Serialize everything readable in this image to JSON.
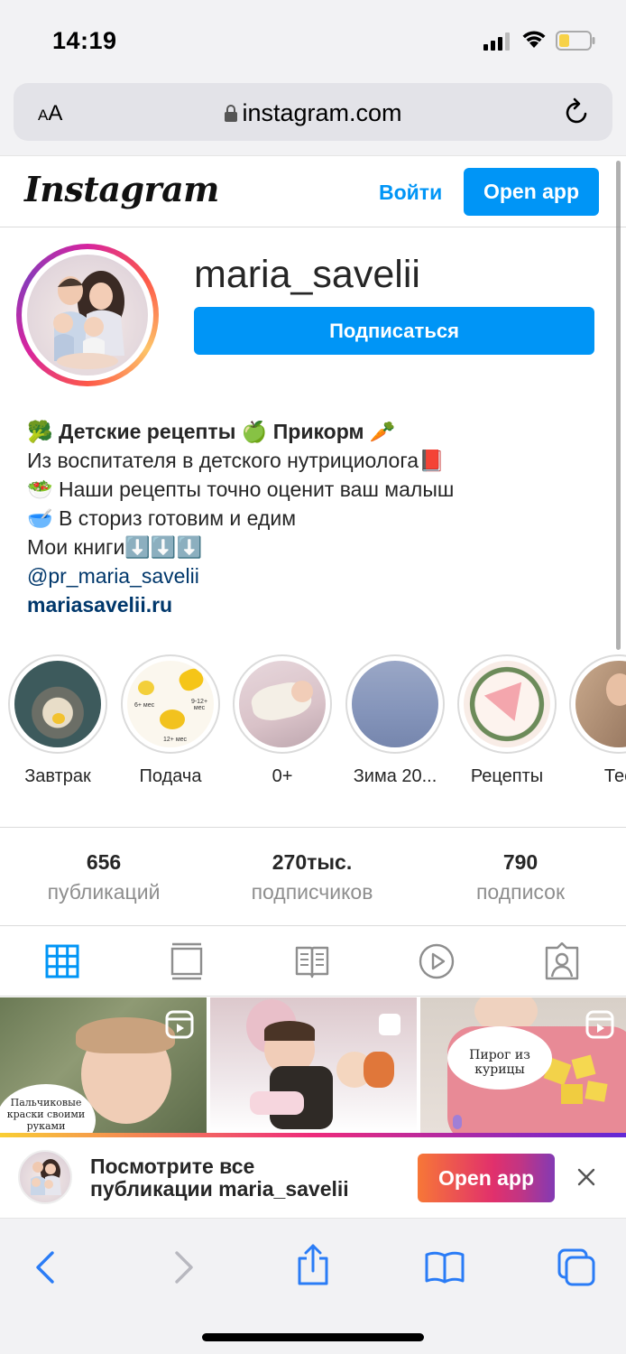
{
  "status": {
    "time": "14:19"
  },
  "browser": {
    "aa_small": "A",
    "aa_large": "A",
    "url": "instagram.com"
  },
  "header": {
    "logo": "Instagram",
    "login": "Войти",
    "open_app": "Open app"
  },
  "profile": {
    "username": "maria_savelii",
    "follow": "Подписаться",
    "bio": [
      "🥦 Детские рецепты 🍏 Прикорм 🥕",
      "Из воспитателя в детского нутрициолога📕",
      "🥗 Наши рецепты точно оценит ваш малыш",
      "🥣 В сториз готовим и едим",
      "Мои книги⬇️⬇️⬇️"
    ],
    "mention": "@pr_maria_savelii",
    "website": "mariasavelii.ru"
  },
  "highlights": [
    {
      "label": "Завтрак"
    },
    {
      "label": "Подача"
    },
    {
      "label": "0+"
    },
    {
      "label": "Зима 20..."
    },
    {
      "label": "Рецепты"
    },
    {
      "label": "Тес"
    }
  ],
  "highlight_texts": {
    "podacha_a": "6+ мес",
    "podacha_b": "9-12+ мес",
    "podacha_c": "12+ мес"
  },
  "stats": [
    {
      "value": "656",
      "label": "публикаций"
    },
    {
      "value": "270тыс.",
      "label": "подписчиков"
    },
    {
      "value": "790",
      "label": "подписок"
    }
  ],
  "posts": [
    {
      "caption": "Пальчиковые краски своими руками"
    },
    {
      "caption": ""
    },
    {
      "caption": "Пирог из курицы"
    }
  ],
  "banner": {
    "line1": "Посмотрите все",
    "line2": "публикации maria_savelii",
    "open_app": "Open app"
  },
  "colors": {
    "primary_blue": "#0095f6",
    "link_dark": "#00376b",
    "muted": "#8e8e8e",
    "safari_blue": "#2a7cf6"
  }
}
